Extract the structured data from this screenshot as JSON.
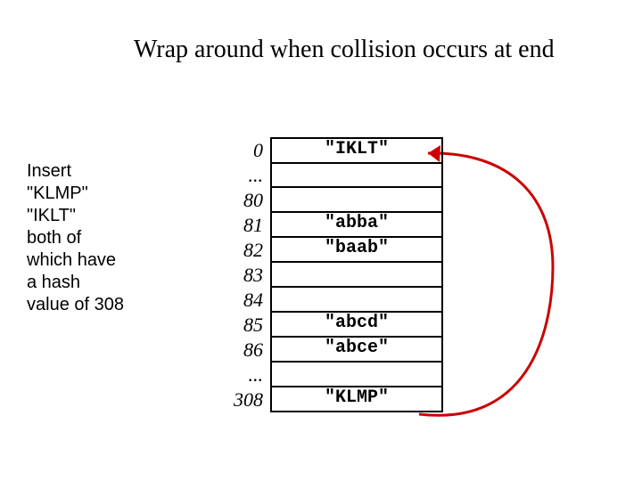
{
  "title": "Wrap around when collision occurs at end",
  "left_text": {
    "l1": "Insert",
    "l2": "\"KLMP\"",
    "l3": "\"IKLT\"",
    "l4": "both of",
    "l5": "which have",
    "l6": "a hash",
    "l7": "value of 308"
  },
  "table": {
    "rows": [
      {
        "index": "0",
        "value": "\"IKLT\""
      },
      {
        "index": "...",
        "value": ""
      },
      {
        "index": "80",
        "value": ""
      },
      {
        "index": "81",
        "value": "\"abba\""
      },
      {
        "index": "82",
        "value": "\"baab\""
      },
      {
        "index": "83",
        "value": ""
      },
      {
        "index": "84",
        "value": ""
      },
      {
        "index": "85",
        "value": "\"abcd\""
      },
      {
        "index": "86",
        "value": "\"abce\""
      },
      {
        "index": "...",
        "value": ""
      },
      {
        "index": "308",
        "value": "\"KLMP\""
      }
    ]
  }
}
